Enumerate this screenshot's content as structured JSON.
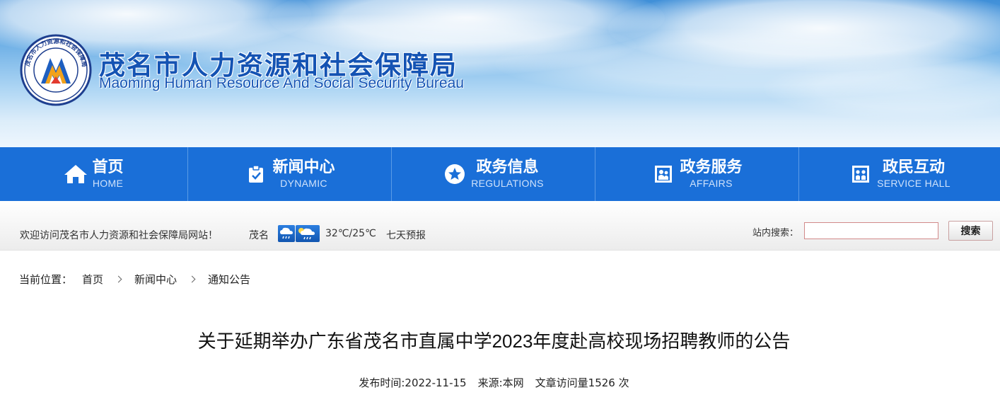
{
  "header": {
    "title": "茂名市人力资源和社会保障局",
    "subtitle": "Maoming Human Resource And Social Security Bureau",
    "logo": {
      "ring_text": "茂名市人力资源和社会保障局",
      "icon": "bureau-seal-logo"
    }
  },
  "nav": {
    "items": [
      {
        "label": "首页",
        "sublabel": "HOME",
        "icon": "home-icon"
      },
      {
        "label": "新闻中心",
        "sublabel": "DYNAMIC",
        "icon": "clipboard-check-icon"
      },
      {
        "label": "政务信息",
        "sublabel": "REGULATIONS",
        "icon": "star-icon"
      },
      {
        "label": "政务服务",
        "sublabel": "AFFAIRS",
        "icon": "service-hall-icon"
      },
      {
        "label": "政民互动",
        "sublabel": "SERVICE HALL",
        "icon": "interaction-icon"
      }
    ],
    "color": "#1a6fd8"
  },
  "infobar": {
    "welcome": "欢迎访问茂名市人力资源和社会保障局网站！",
    "city": "茂名",
    "weather_icons": [
      "rain-icon",
      "rain-night-icon"
    ],
    "temperature": "32℃/25℃",
    "forecast": "七天预报",
    "search_label": "站内搜索：",
    "search_value": "",
    "search_button": "搜索"
  },
  "breadcrumb": {
    "lead": "当前位置：",
    "items": [
      "首页",
      "新闻中心",
      "通知公告"
    ]
  },
  "article": {
    "title": "关于延期举办广东省茂名市直属中学2023年度赴高校现场招聘教师的公告",
    "published": "发布时间:2022-11-15",
    "source": "来源:本网",
    "views": "文章访问量1526 次"
  },
  "colors": {
    "brand_blue": "#1453b3",
    "nav_blue": "#1a6fd8"
  }
}
